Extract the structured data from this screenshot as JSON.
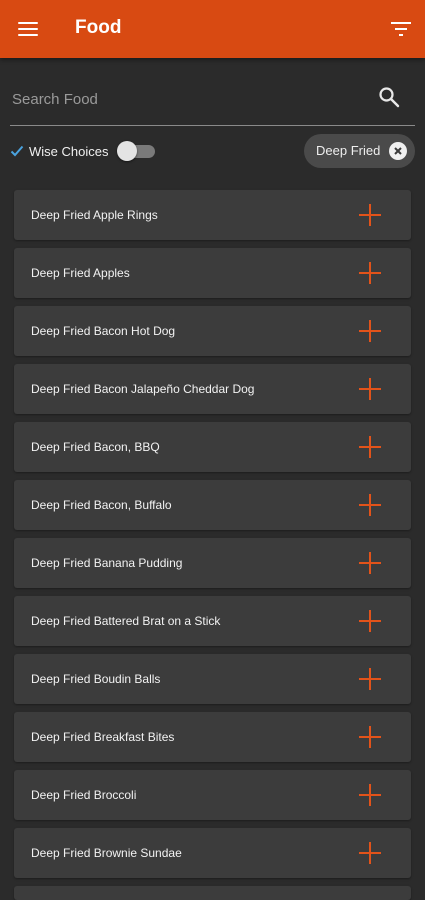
{
  "app_bar": {
    "title": "Food",
    "accent": "#d84a12",
    "menu_icon": "hamburger-menu-icon",
    "filter_icon": "filter-icon"
  },
  "search": {
    "placeholder": "Search Food",
    "value": "",
    "icon": "search-icon"
  },
  "filters": {
    "wise_choices_label": "Wise Choices",
    "wise_choices_checked": true,
    "wise_choices_toggle_on": false,
    "active_chip_label": "Deep Fried"
  },
  "food_items": [
    {
      "name": "Deep Fried Apple Rings"
    },
    {
      "name": "Deep Fried Apples"
    },
    {
      "name": "Deep Fried Bacon Hot Dog"
    },
    {
      "name": "Deep Fried Bacon Jalapeño Cheddar Dog"
    },
    {
      "name": "Deep Fried Bacon, BBQ"
    },
    {
      "name": "Deep Fried Bacon, Buffalo"
    },
    {
      "name": "Deep Fried Banana Pudding"
    },
    {
      "name": "Deep Fried Battered Brat on a Stick"
    },
    {
      "name": "Deep Fried Boudin Balls"
    },
    {
      "name": "Deep Fried Breakfast Bites"
    },
    {
      "name": "Deep Fried Broccoli"
    },
    {
      "name": "Deep Fried Brownie Sundae"
    }
  ]
}
